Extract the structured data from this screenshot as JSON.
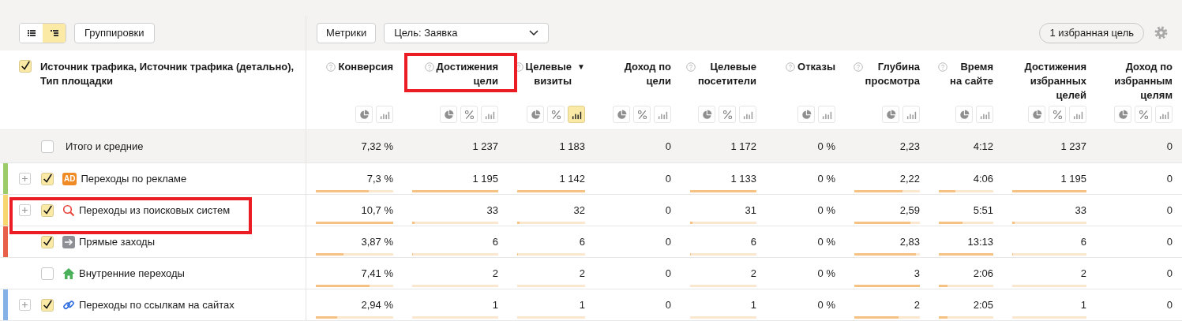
{
  "toolbar": {
    "view_toggle": [
      {
        "kind": "list",
        "selected": false
      },
      {
        "kind": "tree",
        "selected": true
      }
    ],
    "groupings_button": "Группировки",
    "metrics_button": "Метрики",
    "goal_select": "Цель: Заявка",
    "favorite_goals_button": "1 избранная цель"
  },
  "table": {
    "dimension_header": {
      "label": "Источник трафика, Источник трафика (детально), Тип площадки",
      "checked": true
    },
    "columns": [
      {
        "title": "Конверсия",
        "help": true,
        "highlighted": false,
        "buttons": [
          {
            "kind": "pie",
            "selected": false
          },
          {
            "kind": "bars",
            "selected": false
          }
        ]
      },
      {
        "title": "Достижения\nцели",
        "help": true,
        "highlighted": true,
        "buttons": [
          {
            "kind": "pie",
            "selected": false
          },
          {
            "kind": "percent",
            "selected": false
          },
          {
            "kind": "bars",
            "selected": false
          }
        ]
      },
      {
        "title": "Целевые\nвизиты",
        "help": true,
        "sort_mark": "▼",
        "highlighted": false,
        "buttons": [
          {
            "kind": "pie",
            "selected": false
          },
          {
            "kind": "percent",
            "selected": false
          },
          {
            "kind": "bars",
            "selected": true
          }
        ]
      },
      {
        "title": "Доход по\nцели",
        "help": false,
        "highlighted": false,
        "buttons": [
          {
            "kind": "pie",
            "selected": false
          },
          {
            "kind": "percent",
            "selected": false
          },
          {
            "kind": "bars",
            "selected": false
          }
        ]
      },
      {
        "title": "Целевые\nпосетители",
        "help": true,
        "highlighted": false,
        "buttons": [
          {
            "kind": "pie",
            "selected": false
          },
          {
            "kind": "percent",
            "selected": false
          },
          {
            "kind": "bars",
            "selected": false
          }
        ]
      },
      {
        "title": "Отказы",
        "help": true,
        "highlighted": false,
        "buttons": [
          {
            "kind": "pie",
            "selected": false
          },
          {
            "kind": "bars",
            "selected": false
          }
        ]
      },
      {
        "title": "Глубина\nпросмотра",
        "help": true,
        "highlighted": false,
        "buttons": [
          {
            "kind": "pie",
            "selected": false
          },
          {
            "kind": "bars",
            "selected": false
          }
        ]
      },
      {
        "title": "Время\nна сайте",
        "help": true,
        "highlighted": false,
        "buttons": [
          {
            "kind": "pie",
            "selected": false
          },
          {
            "kind": "bars",
            "selected": false
          }
        ]
      },
      {
        "title": "Достижения\nизбранных\nцелей",
        "help": false,
        "highlighted": false,
        "buttons": [
          {
            "kind": "pie",
            "selected": false
          },
          {
            "kind": "percent",
            "selected": false
          },
          {
            "kind": "bars",
            "selected": false
          }
        ]
      },
      {
        "title": "Доход по\nизбранным\nцелям",
        "help": false,
        "highlighted": false,
        "buttons": [
          {
            "kind": "pie",
            "selected": false
          },
          {
            "kind": "percent",
            "selected": false
          },
          {
            "kind": "bars",
            "selected": false
          }
        ]
      }
    ],
    "total_row": {
      "label": "Итого и средние",
      "checked": false,
      "cells": [
        "7,32 %",
        "1 237",
        "1 183",
        "0",
        "1 172",
        "0 %",
        "2,23",
        "4:12",
        "1 237",
        "0"
      ]
    },
    "rows": [
      {
        "kind": "ad",
        "badge": "AD",
        "label": "Переходы по рекламе",
        "checked": true,
        "expandable": true,
        "highlighted": false,
        "color": "#9ccb6a",
        "cells": [
          {
            "text": "7,3 %",
            "level": 0.68
          },
          {
            "text": "1 195",
            "level": 1
          },
          {
            "text": "1 142",
            "level": 1
          },
          "0",
          {
            "text": "1 133",
            "level": 1
          },
          "0 %",
          {
            "text": "2,22",
            "level": 0.74
          },
          {
            "text": "4:06",
            "level": 0.31
          },
          {
            "text": "1 195",
            "level": 1
          },
          "0"
        ]
      },
      {
        "kind": "search",
        "label": "Переходы из поисковых систем",
        "checked": true,
        "expandable": true,
        "highlighted": true,
        "color": "#f7d56f",
        "cells": [
          {
            "text": "10,7 %",
            "level": 1
          },
          {
            "text": "33",
            "level": 0.03
          },
          {
            "text": "32",
            "level": 0.03
          },
          "0",
          {
            "text": "31",
            "level": 0.03
          },
          "0 %",
          {
            "text": "2,59",
            "level": 0.85
          },
          {
            "text": "5:51",
            "level": 0.44
          },
          {
            "text": "33",
            "level": 0.03
          },
          "0"
        ]
      },
      {
        "kind": "direct",
        "label": "Прямые заходы",
        "checked": true,
        "expandable": false,
        "highlighted": false,
        "color": "#e9604a",
        "cells": [
          {
            "text": "3,87 %",
            "level": 0.36
          },
          {
            "text": "6",
            "level": 0.005
          },
          {
            "text": "6",
            "level": 0.005
          },
          "0",
          {
            "text": "6",
            "level": 0.005
          },
          "0 %",
          {
            "text": "2,83",
            "level": 0.94
          },
          {
            "text": "13:13",
            "level": 1
          },
          {
            "text": "6",
            "level": 0.005
          },
          "0"
        ]
      },
      {
        "kind": "internal",
        "label": "Внутренние переходы",
        "checked": false,
        "expandable": false,
        "highlighted": false,
        "cells": [
          {
            "text": "7,41 %",
            "level": 0.69
          },
          {
            "text": "2",
            "level": 0
          },
          {
            "text": "2",
            "level": 0
          },
          "0",
          {
            "text": "2",
            "level": 0
          },
          "0 %",
          {
            "text": "3",
            "level": 1
          },
          {
            "text": "2:06",
            "level": 0.16
          },
          {
            "text": "2",
            "level": 0
          },
          "0"
        ]
      },
      {
        "kind": "link",
        "label": "Переходы по ссылкам на сайтах",
        "checked": true,
        "expandable": true,
        "highlighted": false,
        "color": "#86b1e6",
        "cells": [
          {
            "text": "2,94 %",
            "level": 0.28
          },
          {
            "text": "1",
            "level": 0
          },
          {
            "text": "1",
            "level": 0
          },
          "0",
          {
            "text": "1",
            "level": 0
          },
          "0 %",
          {
            "text": "2",
            "level": 0.67
          },
          {
            "text": "2:05",
            "level": 0.16
          },
          {
            "text": "1",
            "level": 0
          },
          "0"
        ]
      }
    ]
  }
}
